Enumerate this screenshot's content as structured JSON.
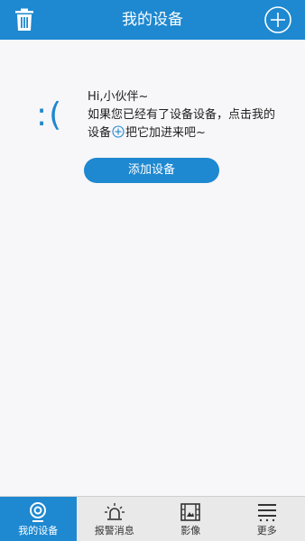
{
  "header": {
    "title": "我的设备",
    "left_icon": "trash-icon",
    "right_icon": "add-circle-icon"
  },
  "empty_state": {
    "face": ":(",
    "greeting": "Hi,小伙伴~",
    "line2": "如果您已经有了设备设备，点击我的",
    "line3_before": "设备",
    "line3_after": "把它加进来吧~",
    "inline_icon": "add-circle-icon",
    "button_label": "添加设备"
  },
  "tabs": [
    {
      "label": "我的设备",
      "icon": "camera-icon",
      "active": true
    },
    {
      "label": "报警消息",
      "icon": "alarm-light-icon",
      "active": false
    },
    {
      "label": "影像",
      "icon": "film-icon",
      "active": false
    },
    {
      "label": "更多",
      "icon": "menu-icon",
      "active": false
    }
  ],
  "colors": {
    "primary": "#1e88d0",
    "background": "#f7f6f8",
    "tabbar": "#e9e9e9"
  }
}
